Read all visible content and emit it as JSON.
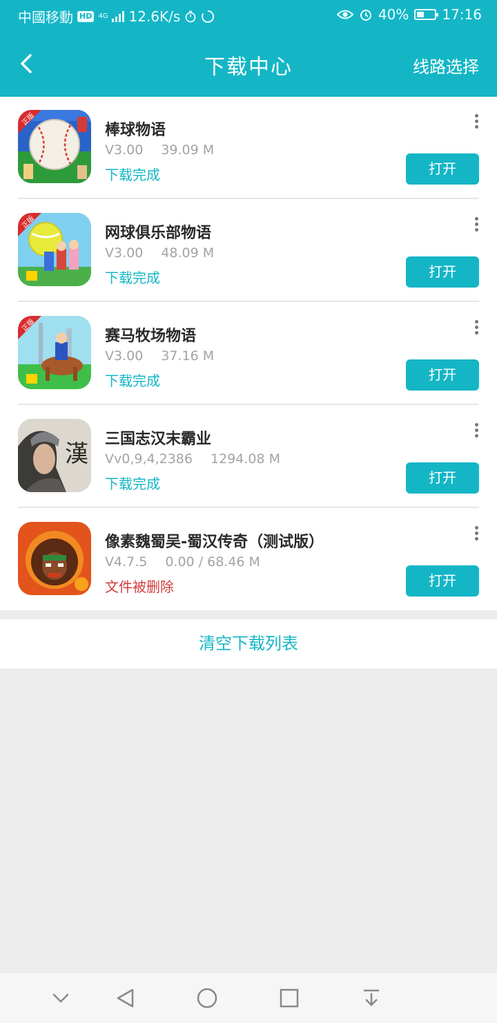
{
  "status_bar": {
    "carrier": "中國移動",
    "hd": "HD",
    "network": "4G",
    "speed": "12.6K/s",
    "battery": "40%",
    "battery_level": 0.4,
    "time": "17:16"
  },
  "header": {
    "title": "下载中心",
    "route_label": "线路选择"
  },
  "downloads": [
    {
      "name": "棒球物语",
      "version": "V3.00",
      "size": "39.09 M",
      "status": "下载完成",
      "button": "打开",
      "icon_label": "正版"
    },
    {
      "name": "网球俱乐部物语",
      "version": "V3.00",
      "size": "48.09 M",
      "status": "下载完成",
      "button": "打开",
      "icon_label": "正版"
    },
    {
      "name": "赛马牧场物语",
      "version": "V3.00",
      "size": "37.16 M",
      "status": "下载完成",
      "button": "打开",
      "icon_label": "正版"
    },
    {
      "name": "三国志汉末霸业",
      "version": "Vv0,9,4,2386",
      "size": "1294.08 M",
      "status": "下载完成",
      "button": "打开",
      "icon_label": "漢"
    },
    {
      "name": "像素魏蜀吴-蜀汉传奇（测试版）",
      "version": "V4.7.5",
      "size": "0.00 / 68.46 M",
      "status": "文件被删除",
      "button": "打开"
    }
  ],
  "clear_label": "清空下载列表",
  "colors": {
    "accent": "#14b6c6",
    "deleted": "#d43b3b",
    "background": "#ececec"
  },
  "icons": [
    "back-icon",
    "more-icon",
    "eye-icon",
    "alarm-icon",
    "battery-icon",
    "timer-icon",
    "chevron-down-icon",
    "back-triangle-icon",
    "home-circle-icon",
    "recents-square-icon",
    "notification-pull-icon"
  ]
}
